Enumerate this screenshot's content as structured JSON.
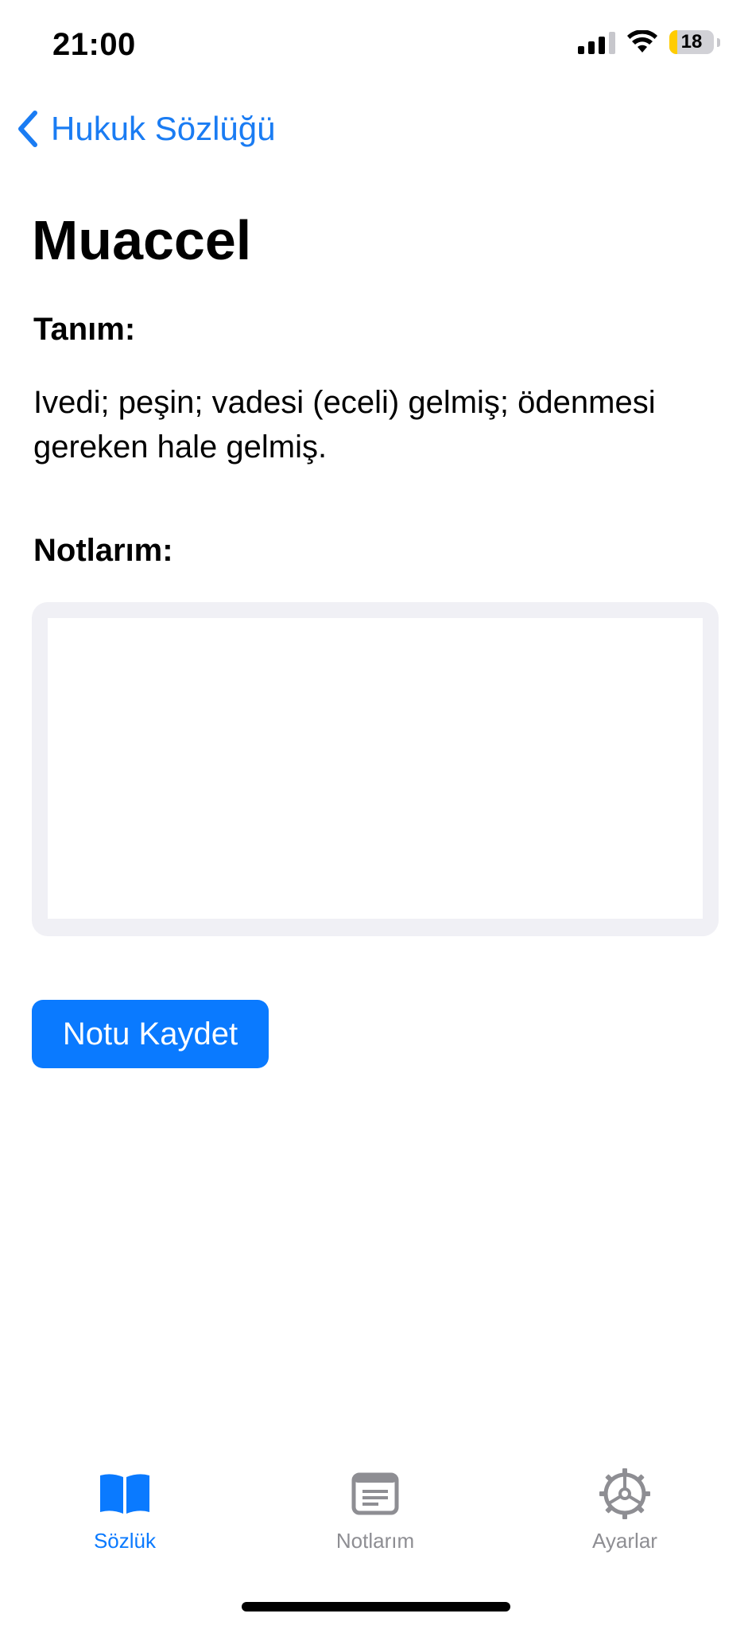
{
  "status_bar": {
    "time": "21:00",
    "battery_level": "18",
    "battery_fraction": 0.18,
    "signal_bars_active": 3,
    "signal_bars_total": 4
  },
  "nav": {
    "back_label": "Hukuk Sözlüğü"
  },
  "term": {
    "title": "Muaccel",
    "definition_heading": "Tanım:",
    "definition_text": "Ivedi; peşin; vadesi (eceli) gelmiş; ödenmesi gereken hale gelmiş."
  },
  "notes": {
    "heading": "Notlarım:",
    "value": "",
    "save_label": "Notu Kaydet"
  },
  "tab_bar": {
    "tabs": [
      {
        "label": "Sözlük",
        "icon": "book-icon",
        "active": true
      },
      {
        "label": "Notlarım",
        "icon": "note-icon",
        "active": false
      },
      {
        "label": "Ayarlar",
        "icon": "gear-icon",
        "active": false
      }
    ]
  },
  "colors": {
    "accent": "#0a7aff",
    "inactive_tab": "#8e8e93",
    "battery_fill": "#ffcc00",
    "notes_frame": "#f0f0f5"
  }
}
